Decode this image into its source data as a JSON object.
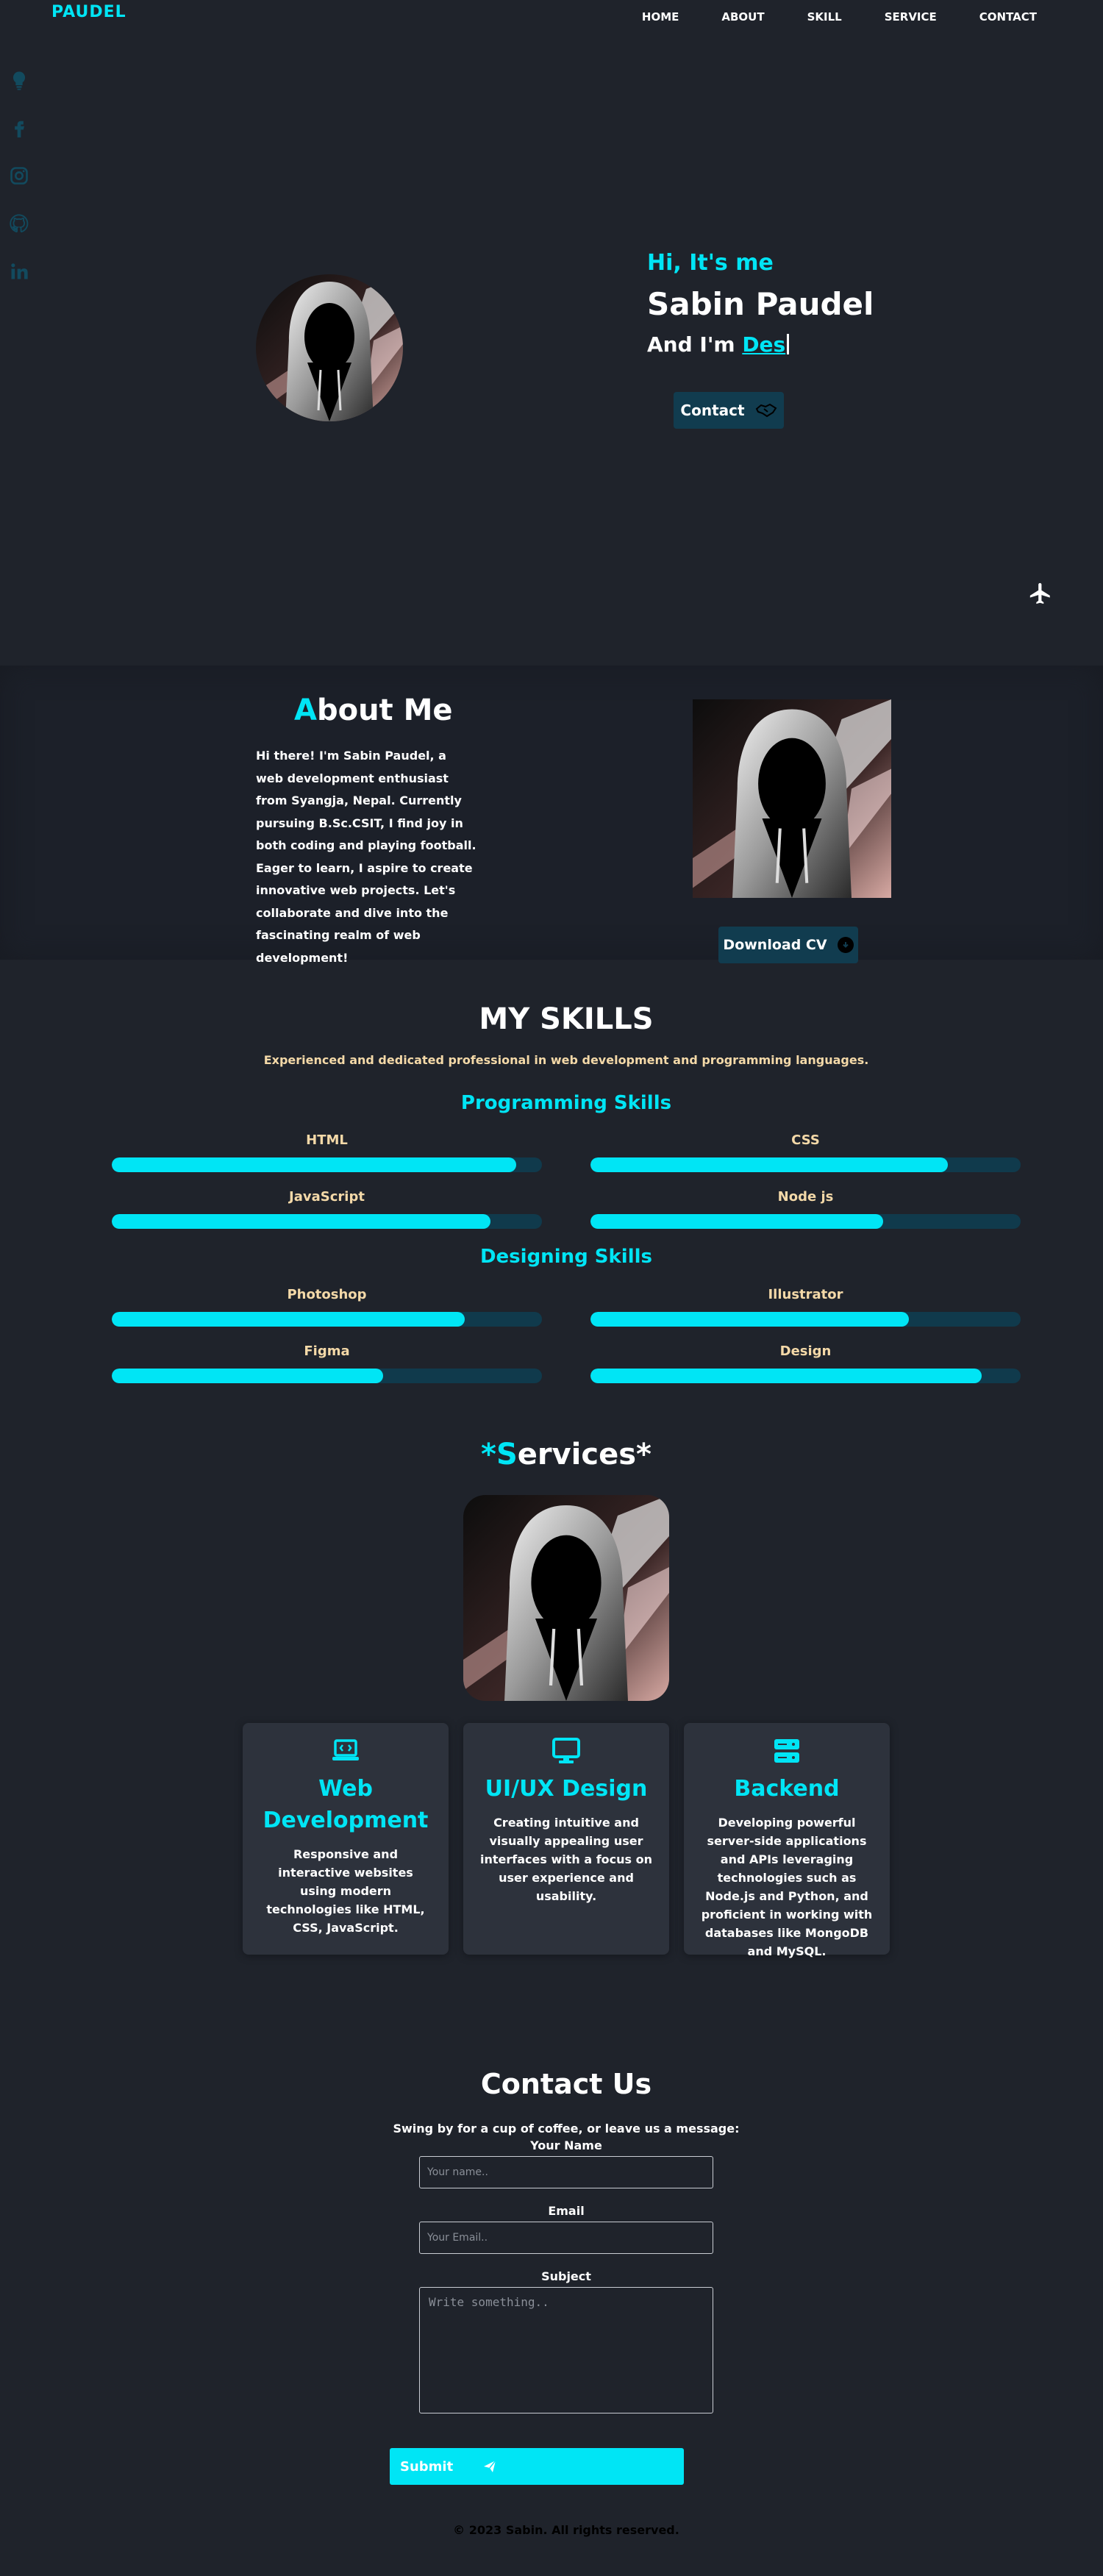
{
  "nav": {
    "logo": "PAUDEL",
    "items": [
      {
        "label": "HOME"
      },
      {
        "label": "ABOUT"
      },
      {
        "label": "SKILL"
      },
      {
        "label": "SERVICE"
      },
      {
        "label": "CONTACT"
      }
    ]
  },
  "social": [
    "lightbulb-icon",
    "facebook-icon",
    "instagram-icon",
    "github-icon",
    "linkedin-icon"
  ],
  "hero": {
    "greeting": "Hi, It's me",
    "name": "Sabin Paudel",
    "and_im": "And I'm ",
    "typed": "Des",
    "contact_label": "Contact"
  },
  "about": {
    "title_first": "A",
    "title_rest": "bout Me",
    "text": "Hi there! I'm Sabin Paudel, a web development enthusiast from Syangja, Nepal. Currently pursuing B.Sc.CSIT, I find joy in both coding and playing football. Eager to learn, I aspire to create innovative web projects. Let's collaborate and dive into the fascinating realm of web development!",
    "cv_label": "Download CV"
  },
  "skills": {
    "title": "MY SKILLS",
    "subtitle": "Experienced and dedicated professional in web development and programming languages.",
    "groups": [
      {
        "title": "Programming Skills",
        "items": [
          {
            "name": "HTML",
            "level": 0.94
          },
          {
            "name": "CSS",
            "level": 0.83
          },
          {
            "name": "JavaScript",
            "level": 0.88
          },
          {
            "name": "Node js",
            "level": 0.68
          }
        ]
      },
      {
        "title": "Designing Skills",
        "items": [
          {
            "name": "Photoshop",
            "level": 0.82
          },
          {
            "name": "Illustrator",
            "level": 0.74
          },
          {
            "name": "Figma",
            "level": 0.63
          },
          {
            "name": "Design",
            "level": 0.91
          }
        ]
      }
    ]
  },
  "services": {
    "title_star1": "*",
    "title_first": "S",
    "title_rest": "ervices*",
    "cards": [
      {
        "icon": "laptop-code-icon",
        "title": "Web Development",
        "text": "Responsive and interactive websites using modern technologies like HTML, CSS, JavaScript."
      },
      {
        "icon": "desktop-icon",
        "title": "UI/UX Design",
        "text": "Creating intuitive and visually appealing user interfaces with a focus on user experience and usability."
      },
      {
        "icon": "server-icon",
        "title": "Backend",
        "text": "Developing powerful server-side applications and APIs leveraging technologies such as Node.js and Python, and proficient in working with databases like MongoDB and MySQL."
      }
    ]
  },
  "contact": {
    "title": "Contact Us",
    "subtitle": "Swing by for a cup of coffee, or leave us a message:",
    "name_label": "Your Name",
    "name_placeholder": "Your name..",
    "email_label": "Email",
    "email_placeholder": "Your Email..",
    "subject_label": "Subject",
    "subject_placeholder": "Write something..",
    "submit_label": "Submit"
  },
  "footer": "© 2023 Sabin. All rights reserved.",
  "colors": {
    "accent": "#00e5f5",
    "background": "#1f232b",
    "card": "#2d323c",
    "button": "#113c4f"
  }
}
